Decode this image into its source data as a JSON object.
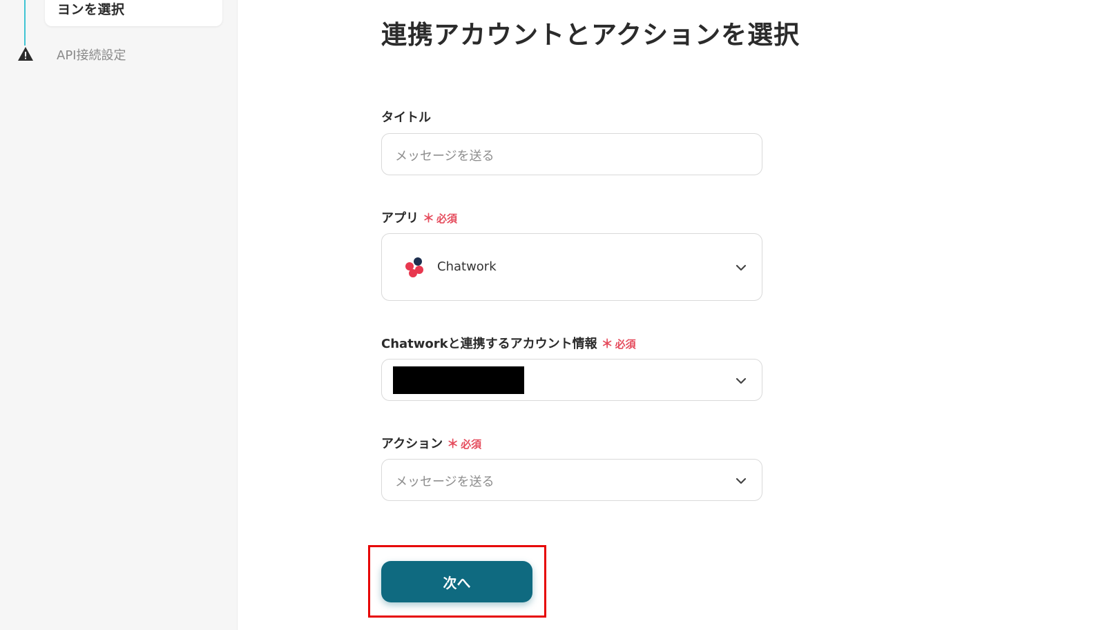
{
  "sidebar": {
    "current_step_label": "ヨンを選択",
    "next_step_label": "API接続設定",
    "step_line_color": "#3fc4d3",
    "warning_icon": "warning-triangle-icon"
  },
  "main": {
    "title": "連携アカウントとアクションを選択",
    "fields": {
      "title_field": {
        "label": "タイトル",
        "value": "メッセージを送る"
      },
      "app_field": {
        "label": "アプリ",
        "required_mark": "＊",
        "required_text": "必須",
        "selected_app": "Chatwork",
        "app_icon": "chatwork-logo-icon"
      },
      "account_field": {
        "label": "Chatworkと連携するアカウント情報",
        "required_mark": "＊",
        "required_text": "必須"
      },
      "action_field": {
        "label": "アクション",
        "required_mark": "＊",
        "required_text": "必須",
        "selected_value": "メッセージを送る"
      }
    },
    "next_button_label": "次へ",
    "accent_color": "#0f6a80",
    "required_color": "#e54b5c",
    "highlight_color": "#e60000"
  }
}
